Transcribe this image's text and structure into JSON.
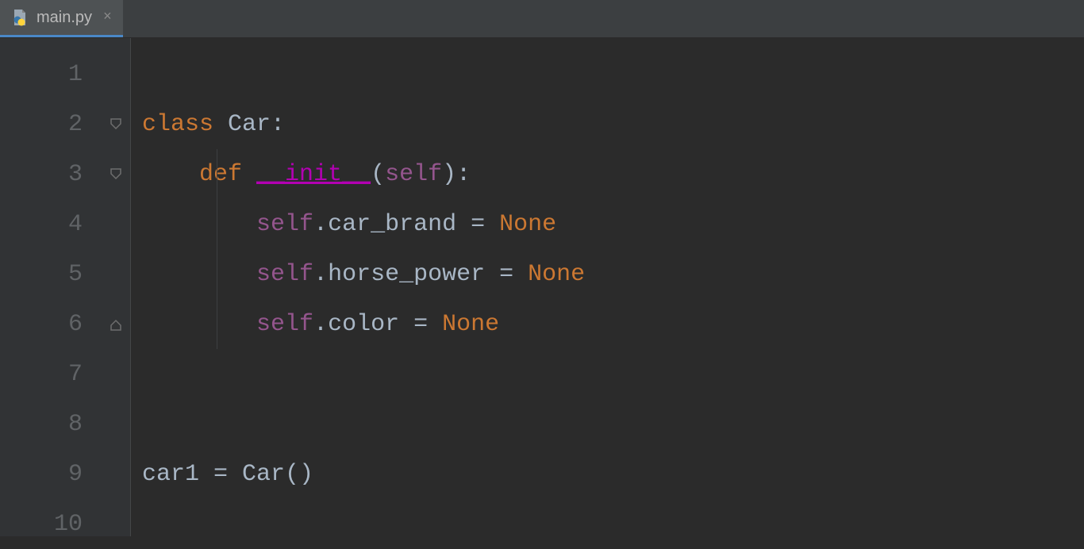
{
  "tab": {
    "filename": "main.py",
    "close_glyph": "×"
  },
  "gutter": {
    "lines": [
      "1",
      "2",
      "3",
      "4",
      "5",
      "6",
      "7",
      "8",
      "9",
      "10"
    ]
  },
  "code": {
    "line1": "",
    "line2": {
      "kw": "class ",
      "name": "Car",
      "colon": ":"
    },
    "line3": {
      "indent": "    ",
      "kw": "def ",
      "fn": "__init__",
      "paren_open": "(",
      "self": "self",
      "paren_close": ")",
      "colon": ":"
    },
    "line4": {
      "indent": "        ",
      "self": "self",
      "dot": ".",
      "attr": "car_brand",
      "eq": " = ",
      "none": "None"
    },
    "line5": {
      "indent": "        ",
      "self": "self",
      "dot": ".",
      "attr": "horse_power",
      "eq": " = ",
      "none": "None"
    },
    "line6": {
      "indent": "        ",
      "self": "self",
      "dot": ".",
      "attr": "color",
      "eq": " = ",
      "none": "None"
    },
    "line7": "",
    "line8": "",
    "line9": {
      "var": "car1",
      "eq": " = ",
      "cls": "Car",
      "paren_open": "(",
      "paren_close": ")"
    },
    "line10": ""
  }
}
